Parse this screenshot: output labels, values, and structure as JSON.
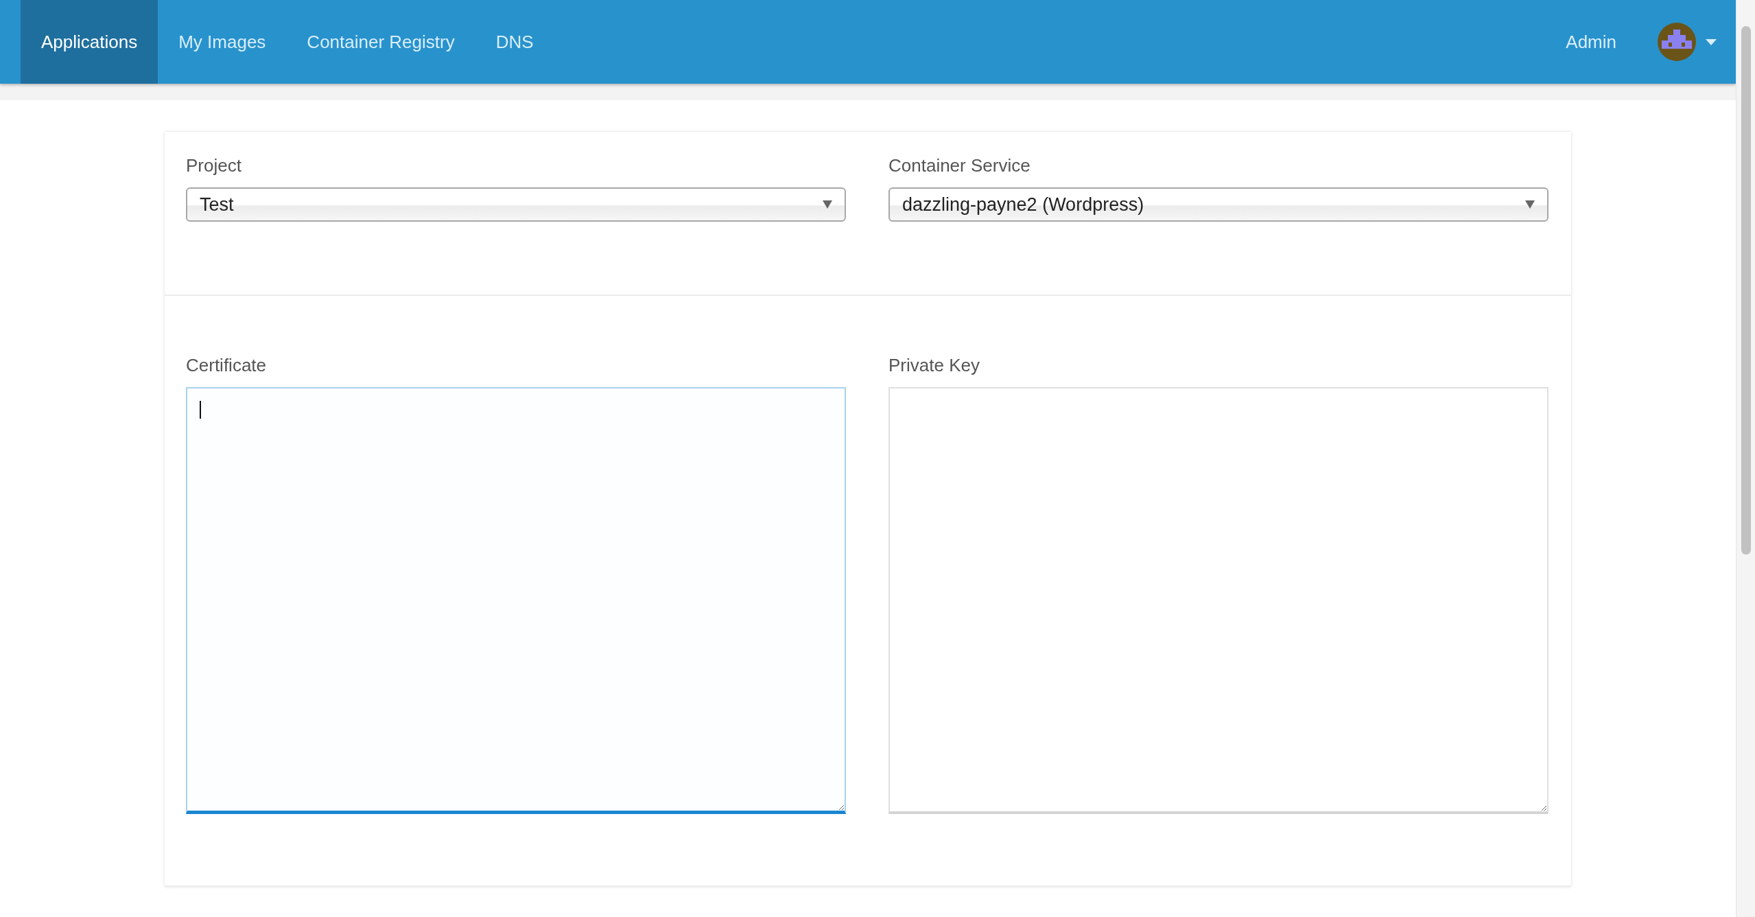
{
  "navbar": {
    "tabs": [
      {
        "label": "Applications",
        "selected": true
      },
      {
        "label": "My Images",
        "selected": false
      },
      {
        "label": "Container Registry",
        "selected": false
      },
      {
        "label": "DNS",
        "selected": false
      }
    ],
    "user": {
      "label": "Admin"
    }
  },
  "selects": [
    {
      "label": "Project",
      "value": "Test"
    },
    {
      "label": "Container Service",
      "value": "dazzling-payne2 (Wordpress)"
    }
  ],
  "textareas": [
    {
      "label": "Certificate",
      "focused": true
    },
    {
      "label": "Private Key",
      "focused": false
    }
  ]
}
